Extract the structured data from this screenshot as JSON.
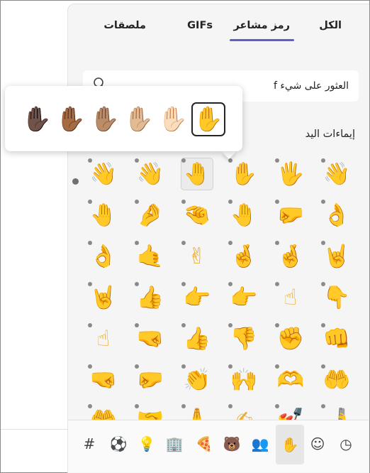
{
  "tabs": [
    {
      "label": "الكل"
    },
    {
      "label": "رمز مشاعر"
    },
    {
      "label": "GIFs"
    },
    {
      "label": "ملصقات"
    }
  ],
  "search": {
    "value": "العثور على شيء f"
  },
  "section": {
    "title": "إيماءات اليد"
  },
  "skin_tones": [
    "✋",
    "✋🏻",
    "✋🏼",
    "✋🏽",
    "✋🏾",
    "✋🏿"
  ],
  "emoji_rows": [
    [
      "👋",
      "🖐",
      "✋",
      "🤚",
      "👋",
      "👋"
    ],
    [
      "👌",
      "🤛",
      "🤚",
      "🤏",
      "🤌",
      "🤚"
    ],
    [
      "🤘",
      "🤞",
      "🤞",
      "✌",
      "🤙",
      "👌"
    ],
    [
      "👇",
      "☝",
      "👉",
      "👉",
      "👍",
      "🤘"
    ],
    [
      "👊",
      "✊",
      "👎",
      "👍",
      "🤜",
      "☝"
    ],
    [
      "🤲",
      "🫶",
      "🙌",
      "👏",
      "🤛",
      "🤜"
    ],
    [
      "🤳",
      "💅",
      "✍",
      "🙏",
      "🤝",
      "🤲"
    ]
  ],
  "categories": [
    {
      "name": "recent-icon",
      "glyph": "◷"
    },
    {
      "name": "smiley-icon",
      "glyph": "☺"
    },
    {
      "name": "hand-icon",
      "glyph": "✋"
    },
    {
      "name": "people-icon",
      "glyph": "👥"
    },
    {
      "name": "animal-icon",
      "glyph": "🐻"
    },
    {
      "name": "food-icon",
      "glyph": "🍕"
    },
    {
      "name": "building-icon",
      "glyph": "🏢"
    },
    {
      "name": "lightbulb-icon",
      "glyph": "💡"
    },
    {
      "name": "ball-icon",
      "glyph": "⚽"
    },
    {
      "name": "hashtag-icon",
      "glyph": "#"
    }
  ],
  "colors": {
    "accent": "#5b5fc7",
    "panel": "#f5f5f5"
  }
}
